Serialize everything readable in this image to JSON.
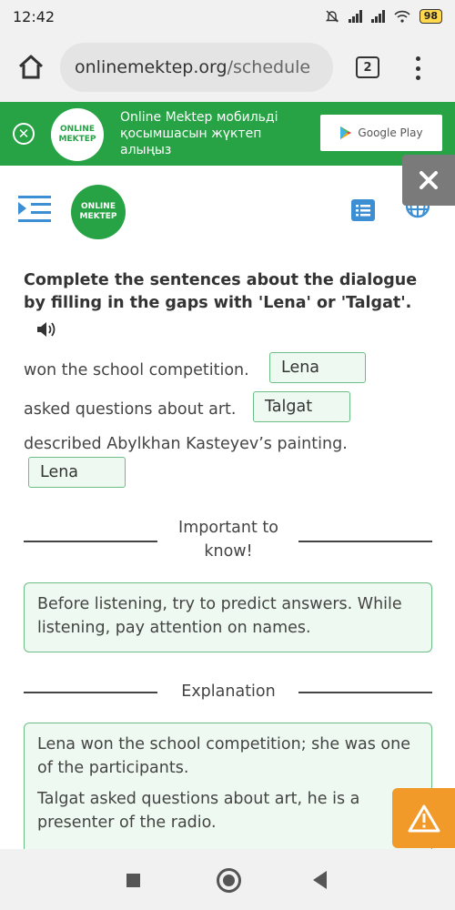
{
  "status_bar": {
    "time": "12:42",
    "battery": "98"
  },
  "browser": {
    "url_host": "onlinemektep.org",
    "url_path": "/schedule",
    "tab_count": "2"
  },
  "banner": {
    "logo_line1": "ONLINE",
    "logo_line2": "MEKTEP",
    "text": "Online Mektep мобильді қосымшасын жүктеп алыңыз",
    "store_label": "Google Play",
    "close_label": "✕"
  },
  "header": {
    "logo_line1": "ONLINE",
    "logo_line2": "MEKTEP"
  },
  "task": {
    "title": "Complete the sentences about the dialogue by filling in the gaps with 'Lena' or 'Talgat'.",
    "sentences": [
      {
        "text": "won the school competition.",
        "answer": "Lena"
      },
      {
        "text": "asked questions about art.",
        "answer": "Talgat"
      },
      {
        "text": "described Abylkhan Kasteyev’s painting.",
        "answer": "Lena"
      }
    ]
  },
  "important": {
    "heading": "Important to know!",
    "body": "Before listening, try to predict answers. While listening, pay attention on names."
  },
  "explanation": {
    "heading": "Explanation",
    "paragraphs": [
      "Lena won the school competition; she was one of the participants.",
      "Talgat asked questions about art, he is a presenter of the radio."
    ]
  },
  "colors": {
    "brand_green": "#27a345",
    "box_border": "#6bbf86",
    "box_bg": "#eef9f1",
    "warning_orange": "#f19a2a"
  }
}
